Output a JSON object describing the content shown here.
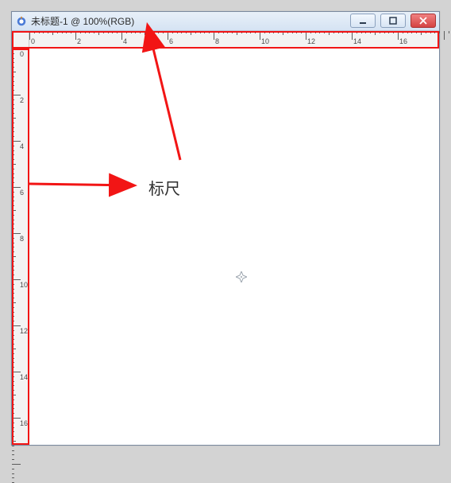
{
  "window": {
    "title": "未标题-1 @ 100%(RGB)"
  },
  "rulers": {
    "h_labels": [
      "0",
      "2",
      "4",
      "6",
      "8",
      "10",
      "12",
      "14",
      "16"
    ],
    "v_labels": [
      "0",
      "2",
      "4",
      "6",
      "8",
      "10",
      "12",
      "14",
      "16"
    ]
  },
  "annotation": {
    "label": "标尺"
  },
  "colors": {
    "highlight": "#f21515"
  }
}
